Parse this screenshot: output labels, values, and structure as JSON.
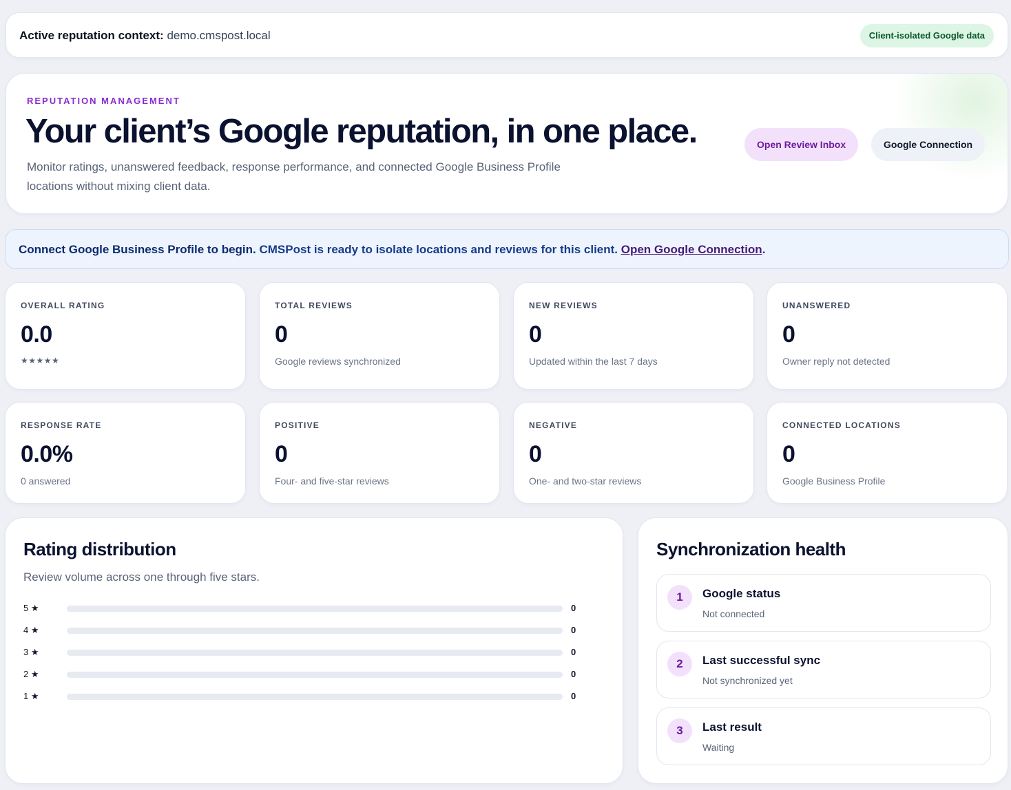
{
  "context": {
    "label": "Active reputation context:",
    "value": "demo.cmspost.local",
    "badge": "Client-isolated Google data"
  },
  "hero": {
    "eyebrow": "REPUTATION MANAGEMENT",
    "title": "Your client’s Google reputation, in one place.",
    "subtitle": "Monitor ratings, unanswered feedback, response performance, and connected Google Business Profile locations without mixing client data.",
    "primary_button": "Open Review Inbox",
    "secondary_button": "Google Connection"
  },
  "banner": {
    "strong": "Connect Google Business Profile to begin.",
    "text": " CMSPost is ready to isolate locations and reviews for this client. ",
    "link": "Open Google Connection",
    "end": "."
  },
  "stats": [
    {
      "label": "OVERALL RATING",
      "value": "0.0",
      "sub": "★★★★★"
    },
    {
      "label": "TOTAL REVIEWS",
      "value": "0",
      "sub": "Google reviews synchronized"
    },
    {
      "label": "NEW REVIEWS",
      "value": "0",
      "sub": "Updated within the last 7 days"
    },
    {
      "label": "UNANSWERED",
      "value": "0",
      "sub": "Owner reply not detected"
    },
    {
      "label": "RESPONSE RATE",
      "value": "0.0%",
      "sub": "0 answered"
    },
    {
      "label": "POSITIVE",
      "value": "0",
      "sub": "Four- and five-star reviews"
    },
    {
      "label": "NEGATIVE",
      "value": "0",
      "sub": "One- and two-star reviews"
    },
    {
      "label": "CONNECTED LOCATIONS",
      "value": "0",
      "sub": "Google Business Profile"
    }
  ],
  "distribution": {
    "title": "Rating distribution",
    "subtitle": "Review volume across one through five stars.",
    "rows": [
      {
        "label": "5 ★",
        "count": "0",
        "fraction": 0
      },
      {
        "label": "4 ★",
        "count": "0",
        "fraction": 0
      },
      {
        "label": "3 ★",
        "count": "0",
        "fraction": 0
      },
      {
        "label": "2 ★",
        "count": "0",
        "fraction": 0
      },
      {
        "label": "1 ★",
        "count": "0",
        "fraction": 0
      }
    ]
  },
  "sync": {
    "title": "Synchronization health",
    "items": [
      {
        "num": "1",
        "title": "Google status",
        "status": "Not connected"
      },
      {
        "num": "2",
        "title": "Last successful sync",
        "status": "Not synchronized yet"
      },
      {
        "num": "3",
        "title": "Last result",
        "status": "Waiting"
      }
    ]
  },
  "colors": {
    "accent": "#7c2bd0",
    "success_badge_bg": "#dcf5e4",
    "banner_bg": "#edf4fe"
  }
}
